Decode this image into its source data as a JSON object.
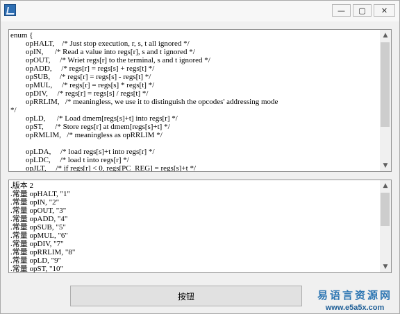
{
  "window": {
    "icon": "app-icon",
    "controls": {
      "minimize": "—",
      "maximize": "▢",
      "close": "✕"
    }
  },
  "editor_top": {
    "text": "enum {\n        opHALT,    /* Just stop execution, r, s, t all ignored */\n        opIN,      /* Read a value into regs[r], s and t ignored */\n        opOUT,     /* Wriet regs[r] to the terminal, s and t ignored */\n        opADD,     /* regs[r] = regs[s] + regs[t] */\n        opSUB,     /* regs[r] = regs[s] - regs[t] */\n        opMUL,     /* regs[r] = regs[s] * regs[t] */\n        opDIV,     /* regs[r] = regs[s] / regs[t] */\n        opRRLIM,   /* meaningless, we use it to distinguish the opcodes' addressing mode\n*/\n        opLD,      /* Load dmem[regs[s]+t] into regs[r] */\n        opST,      /* Store regs[r] at dmem[regs[s]+t] */\n        opRMLIM,   /* meaningless as opRRLIM */\n\n        opLDA,     /* load regs[s]+t into regs[r] */\n        opLDC,     /* load t into regs[r] */\n        opJLT,     /* if regs[r] < 0, regs[PC_REG] = regs[s]+t */"
  },
  "editor_bottom": {
    "text": ".版本 2\n.常量 opHALT, \"1\"\n.常量 opIN, \"2\"\n.常量 opOUT, \"3\"\n.常量 opADD, \"4\"\n.常量 opSUB, \"5\"\n.常量 opMUL, \"6\"\n.常量 opDIV, \"7\"\n.常量 opRRLIM, \"8\"\n.常量 opLD, \"9\"\n.常量 opST, \"10\""
  },
  "scroll": {
    "up_arrow": "▲",
    "down_arrow": "▼"
  },
  "button": {
    "label": "按钮"
  },
  "watermark": {
    "title": "易语言资源网",
    "url": "www.e5a5x.com"
  }
}
